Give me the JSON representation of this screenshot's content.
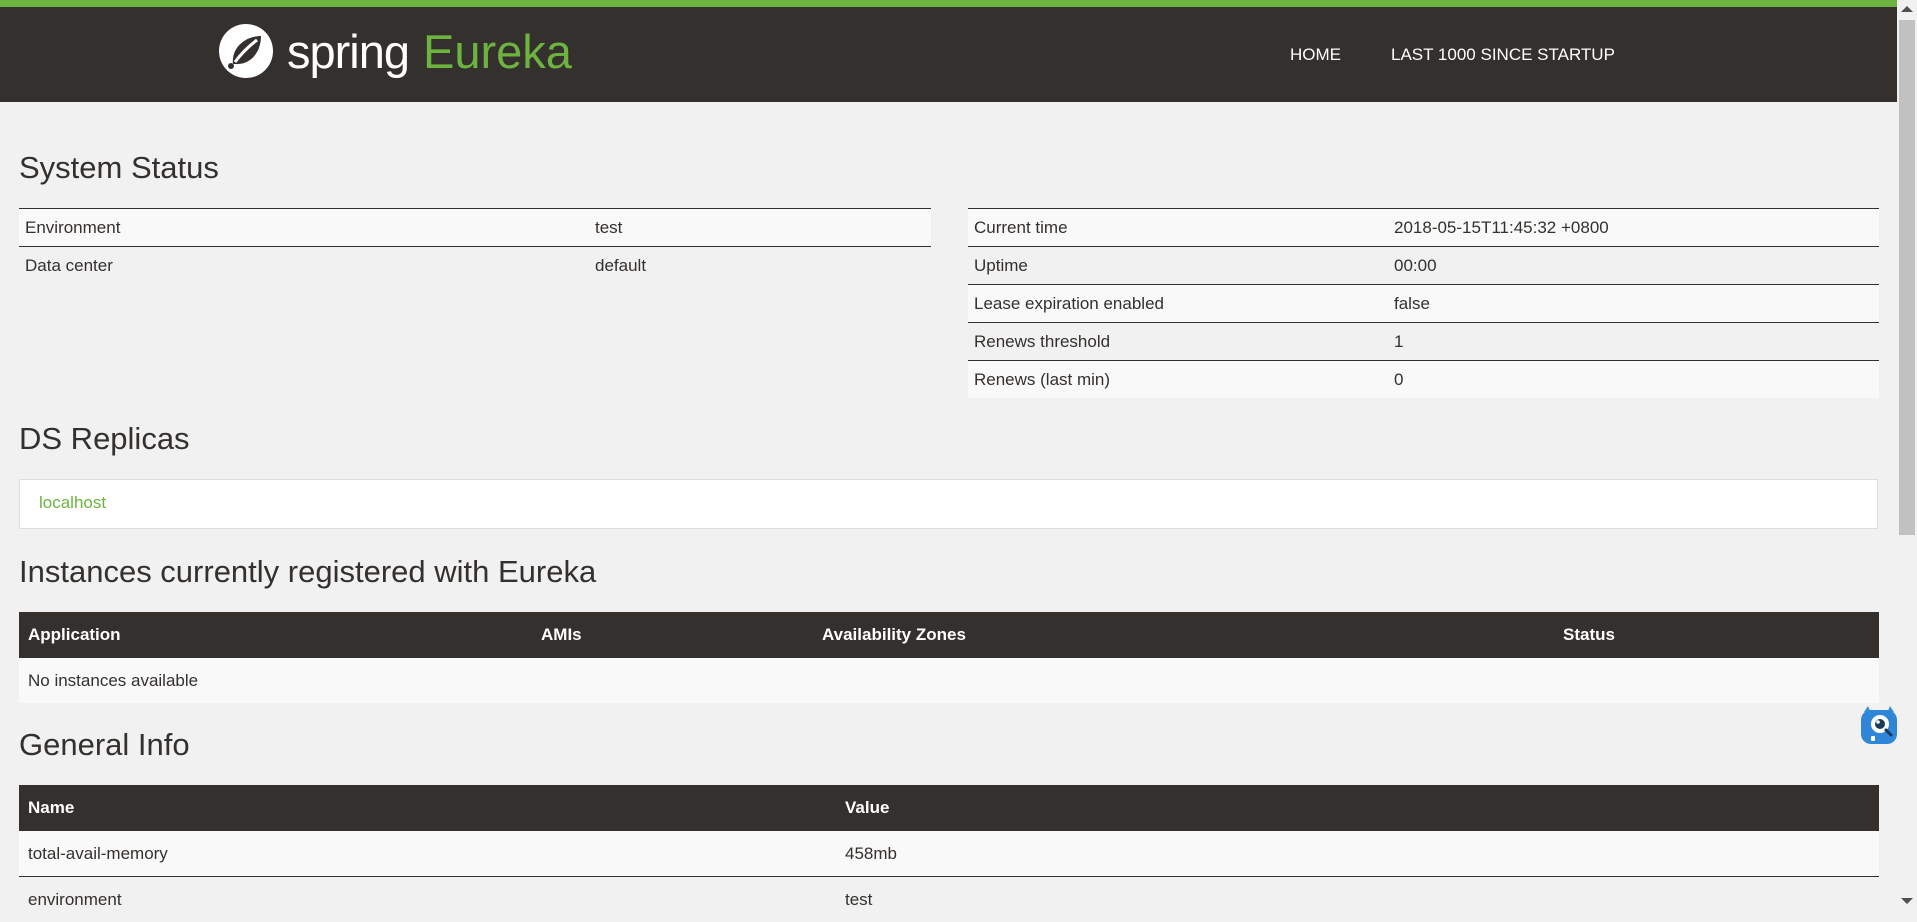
{
  "header": {
    "brand_spring": "spring",
    "brand_eureka": "Eureka",
    "nav": [
      "HOME",
      "LAST 1000 SINCE STARTUP"
    ]
  },
  "system_status": {
    "title": "System Status",
    "left": [
      {
        "label": "Environment",
        "value": "test"
      },
      {
        "label": "Data center",
        "value": "default"
      }
    ],
    "right": [
      {
        "label": "Current time",
        "value": "2018-05-15T11:45:32 +0800"
      },
      {
        "label": "Uptime",
        "value": "00:00"
      },
      {
        "label": "Lease expiration enabled",
        "value": "false"
      },
      {
        "label": "Renews threshold",
        "value": "1"
      },
      {
        "label": "Renews (last min)",
        "value": "0"
      }
    ]
  },
  "ds_replicas": {
    "title": "DS Replicas",
    "items": [
      "localhost"
    ]
  },
  "instances": {
    "title": "Instances currently registered with Eureka",
    "columns": [
      "Application",
      "AMIs",
      "Availability Zones",
      "Status"
    ],
    "empty_message": "No instances available"
  },
  "general_info": {
    "title": "General Info",
    "columns": [
      "Name",
      "Value"
    ],
    "rows": [
      {
        "name": "total-avail-memory",
        "value": "458mb"
      },
      {
        "name": "environment",
        "value": "test"
      }
    ]
  },
  "colors": {
    "accent": "#6db33f",
    "header_bg": "#34302d",
    "page_bg": "#f1f1f1"
  }
}
